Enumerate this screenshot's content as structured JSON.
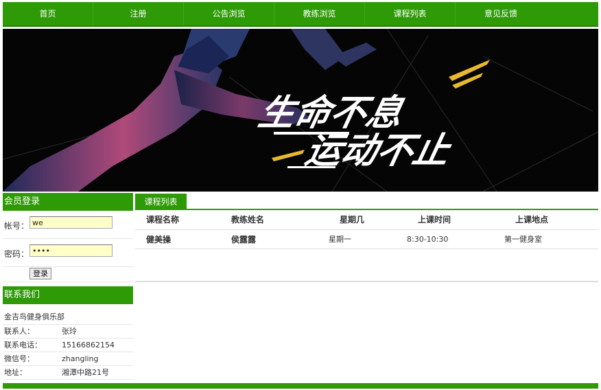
{
  "nav": {
    "items": [
      "首页",
      "注册",
      "公告浏览",
      "教练浏览",
      "课程列表",
      "意见反馈"
    ]
  },
  "banner": {
    "slogan_line1": "生命不息",
    "slogan_line2": "运动不止"
  },
  "login": {
    "title": "会员登录",
    "account_label": "帐号：",
    "account_value": "we",
    "password_label": "密码：",
    "password_value": "••••",
    "submit_label": "登录"
  },
  "contact": {
    "title": "联系我们",
    "org": "金吉鸟健身俱乐部",
    "rows": [
      {
        "key": "联系人：",
        "value": "张玲"
      },
      {
        "key": "联系电话：",
        "value": "15166862154"
      },
      {
        "key": "微信号：",
        "value": "zhangling"
      },
      {
        "key": "地址：",
        "value": "湘潭中路21号"
      }
    ]
  },
  "course": {
    "tab_label": "课程列表",
    "headers": [
      "课程名称",
      "教练姓名",
      "星期几",
      "上课时间",
      "上课地点"
    ],
    "rows": [
      [
        "健美操",
        "侯露露",
        "星期一",
        "8:30-10:30",
        "第一健身室"
      ]
    ]
  },
  "colors": {
    "brand_green": "#2d9a06",
    "input_bg": "#ffffc8"
  }
}
